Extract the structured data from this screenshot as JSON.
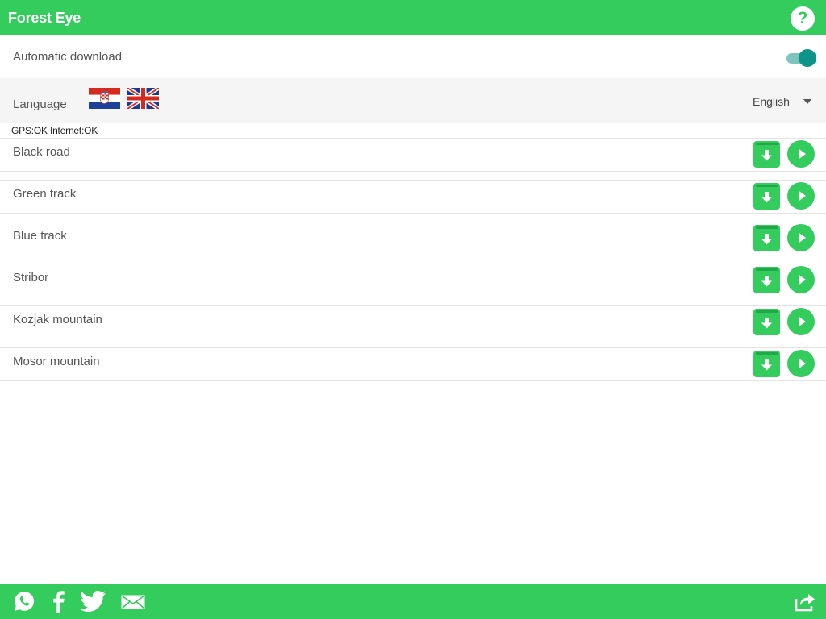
{
  "app": {
    "title": "Forest Eye"
  },
  "header": {
    "help_icon": "question-circle-icon",
    "help_label": "?"
  },
  "settings": {
    "auto_download": {
      "label": "Automatic download",
      "enabled": true
    },
    "language": {
      "label": "Language",
      "flags": [
        "croatian-flag-icon",
        "uk-flag-icon"
      ],
      "selected": "English"
    }
  },
  "status": "GPS:OK Internet:OK",
  "tracks": [
    {
      "name": "Black road"
    },
    {
      "name": "Green track"
    },
    {
      "name": "Blue track"
    },
    {
      "name": "Stribor"
    },
    {
      "name": "Kozjak mountain"
    },
    {
      "name": "Mosor mountain"
    }
  ],
  "track_actions": {
    "download_icon": "download-icon",
    "play_icon": "play-icon"
  },
  "footer": {
    "icons": [
      "whatsapp-icon",
      "facebook-icon",
      "twitter-icon",
      "mail-icon",
      "share-icon"
    ]
  },
  "colors": {
    "brand_green": "#35cc5e",
    "toggle_teal": "#0d9488",
    "white": "#ffffff"
  }
}
